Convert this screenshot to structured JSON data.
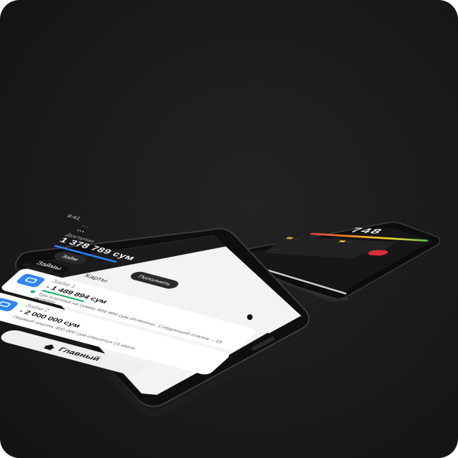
{
  "phone_light": {
    "status_time": "9:41",
    "account_label": "…",
    "account_name": "…",
    "balance_label": "Доступно",
    "balance": "1 378 789 сум",
    "buttons": {
      "withdraw": "Займ",
      "topup": "Пополнить"
    },
    "tabs": [
      "Займы",
      "Карты"
    ],
    "loans": [
      {
        "name": "Займ 1",
        "amount": "- 1 489 894 сум",
        "note": "Три платежа на сумму 889 894 сум оплачены. Следующий платеж – 15 октября"
      },
      {
        "name": "Займ 2",
        "amount": "- 2 000 000 сум",
        "note": "Первый платеж 400 000 сум спишется 15 июля"
      }
    ],
    "main_button": "Главный"
  },
  "phone_dark": {
    "score": "748",
    "cards": [
      {
        "label": "…"
      },
      {
        "label": "…"
      },
      {
        "label": "…"
      }
    ]
  },
  "colors": {
    "accent": "#2f86f6",
    "success": "#19b36b",
    "danger": "#d7303a",
    "background": "#1a1a1a"
  }
}
